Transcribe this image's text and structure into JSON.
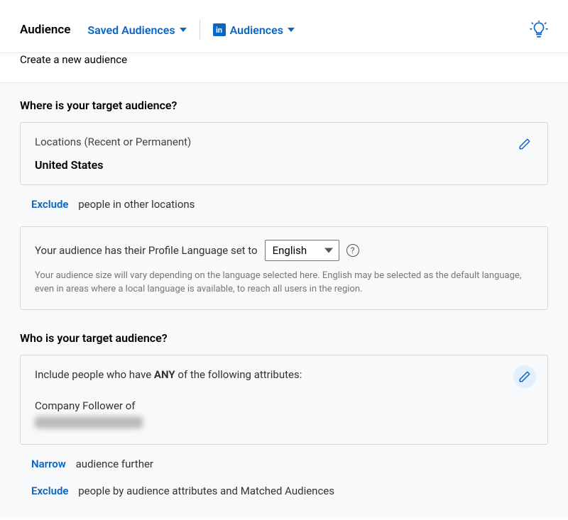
{
  "header": {
    "title": "Audience",
    "saved_audiences_label": "Saved Audiences",
    "audiences_label": "Audiences",
    "li_badge_text": "in"
  },
  "subtitle": "Create a new audience",
  "location_section": {
    "heading": "Where is your target audience?",
    "locations_label": "Locations (Recent or Permanent)",
    "location_value": "United States",
    "exclude_action": "Exclude",
    "exclude_rest": "people in other locations"
  },
  "language_section": {
    "prefix_text": "Your audience has their Profile Language set to",
    "selected_language": "English",
    "note": "Your audience size will vary depending on the language selected here. English may be selected as the default language, even in areas where a local language is available, to reach all users in the region.",
    "help_char": "?"
  },
  "who_section": {
    "heading": "Who is your target audience?",
    "include_prefix": "Include people who have ",
    "include_any": "ANY",
    "include_suffix": " of the following attributes:",
    "attribute_label": "Company Follower of",
    "narrow_action": "Narrow",
    "narrow_rest": "audience further",
    "exclude_action": "Exclude",
    "exclude_rest": "people by audience attributes and Matched Audiences"
  }
}
